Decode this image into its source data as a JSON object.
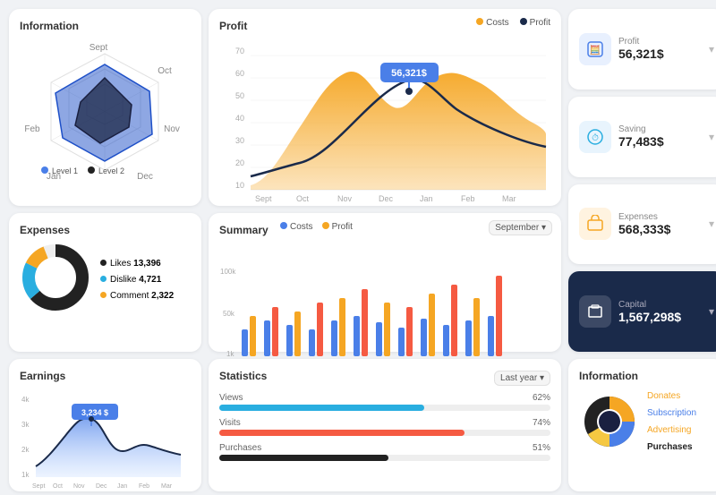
{
  "cards": {
    "information": {
      "title": "Information",
      "levels": [
        "Level 1",
        "Level 2"
      ],
      "axes": [
        "Sept",
        "Oct",
        "Nov",
        "Dec",
        "Jan",
        "Feb"
      ]
    },
    "profit": {
      "title": "Profit",
      "legend": {
        "costs": "Costs",
        "profit": "Profit"
      },
      "callout": "56,321$",
      "yAxis": [
        10,
        20,
        30,
        40,
        50,
        60,
        70
      ],
      "xAxis": [
        "Sept",
        "Oct",
        "Nov",
        "Dec",
        "Jan",
        "Feb",
        "Mar"
      ]
    },
    "stats": [
      {
        "id": "profit",
        "label": "Profit",
        "value": "56,321$",
        "color": "#e8f0fe",
        "iconColor": "#4a7fe8"
      },
      {
        "id": "saving",
        "label": "Saving",
        "value": "77,483$",
        "color": "#e8f4fd",
        "iconColor": "#29aee0"
      },
      {
        "id": "expenses",
        "label": "Expenses",
        "value": "568,333$",
        "color": "#fff3e0",
        "iconColor": "#f5a623"
      },
      {
        "id": "capital",
        "label": "Capital",
        "value": "1,567,298$",
        "color": "#1a2a4a",
        "iconColor": "#fff"
      }
    ],
    "expenses": {
      "title": "Expenses",
      "items": [
        {
          "label": "Likes",
          "value": "13,396",
          "color": "#222"
        },
        {
          "label": "Dislike",
          "value": "4,721",
          "color": "#29aee0"
        },
        {
          "label": "Comment",
          "value": "2,322",
          "color": "#f5a623"
        }
      ]
    },
    "summary": {
      "title": "Summary",
      "legend": {
        "costs": "Costs",
        "profit": "Profit"
      },
      "dropdown": "September",
      "xAxis": [
        "",
        "",
        "",
        "",
        "",
        "",
        "",
        "",
        "",
        "",
        "",
        ""
      ]
    },
    "information_pie": {
      "title": "Information",
      "legend": [
        {
          "label": "Donates",
          "color": "#f5a623"
        },
        {
          "label": "Subscription",
          "color": "#4a7fe8"
        },
        {
          "label": "Advertising",
          "color": "#f5a623"
        },
        {
          "label": "Purchases",
          "color": "#222"
        }
      ]
    },
    "earnings": {
      "title": "Earnings",
      "callout": "3,234 $",
      "yAxis": [
        "1k",
        "2k",
        "3k",
        "4k"
      ],
      "xAxis": [
        "Sept",
        "Oct",
        "Nov",
        "Dec",
        "Jan",
        "Feb",
        "Mar"
      ]
    },
    "statistics": {
      "title": "Statistics",
      "dropdown": "Last year",
      "subLabel": "Views",
      "bars": [
        {
          "label": "Views",
          "percent": 62,
          "pctLabel": "62%",
          "color": "#29aee0"
        },
        {
          "label": "Visits",
          "percent": 74,
          "pctLabel": "74%",
          "color": "#f55a42"
        },
        {
          "label": "Purchases",
          "percent": 51,
          "pctLabel": "51%",
          "color": "#222"
        }
      ]
    }
  }
}
